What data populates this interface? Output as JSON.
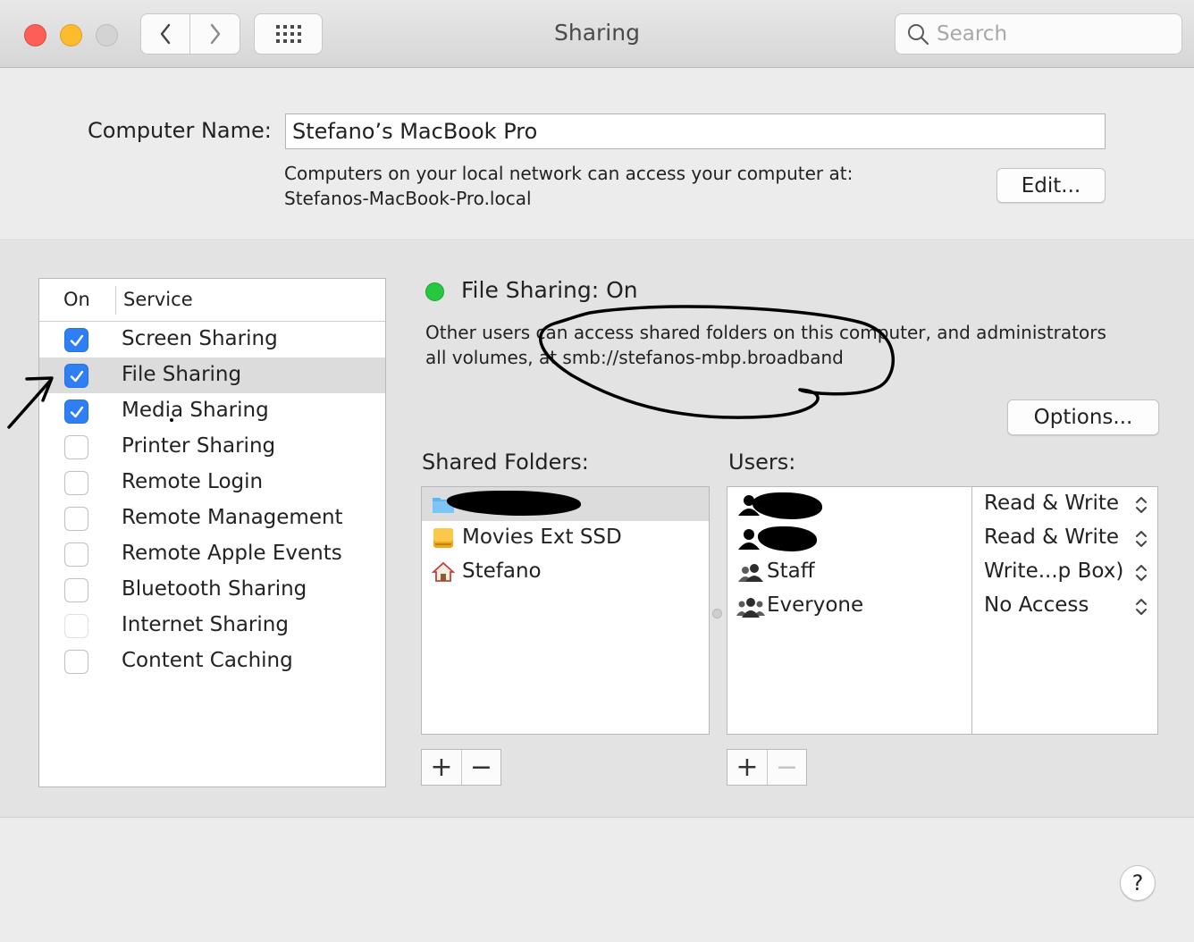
{
  "window": {
    "title": "Sharing",
    "search_placeholder": "Search"
  },
  "computer_name": {
    "label": "Computer Name:",
    "value": "Stefano’s MacBook Pro",
    "description_line1": "Computers on your local network can access your computer at:",
    "description_line2": "Stefanos-MacBook-Pro.local",
    "edit_label": "Edit..."
  },
  "service_list": {
    "col_on": "On",
    "col_service": "Service",
    "items": [
      {
        "label": "Screen Sharing",
        "checked": true
      },
      {
        "label": "File Sharing",
        "checked": true,
        "selected": true
      },
      {
        "label": "Media Sharing",
        "checked": true
      },
      {
        "label": "Printer Sharing",
        "checked": false
      },
      {
        "label": "Remote Login",
        "checked": false
      },
      {
        "label": "Remote Management",
        "checked": false
      },
      {
        "label": "Remote Apple Events",
        "checked": false
      },
      {
        "label": "Bluetooth Sharing",
        "checked": false
      },
      {
        "label": "Internet Sharing",
        "checked": false,
        "disabled": true
      },
      {
        "label": "Content Caching",
        "checked": false
      }
    ]
  },
  "status": {
    "text": "File Sharing: On",
    "color": "#27c840",
    "description_line1": "Other users can access shared folders on this computer, and administrators",
    "description_line2": "all volumes, at smb://stefanos-mbp.broadband"
  },
  "options_label": "Options...",
  "shared_folders": {
    "label": "Shared Folders:",
    "items": [
      {
        "label": "",
        "icon": "folder-icon",
        "selected": true
      },
      {
        "label": "Movies Ext SSD",
        "icon": "drive-icon"
      },
      {
        "label": "Stefano",
        "icon": "home-icon"
      }
    ]
  },
  "users": {
    "label": "Users:",
    "items": [
      {
        "name": "",
        "icon": "user-icon",
        "permission": "Read & Write"
      },
      {
        "name": "",
        "icon": "user-icon",
        "permission": "Read & Write"
      },
      {
        "name": "Staff",
        "icon": "group-icon",
        "permission": "Write...p Box)"
      },
      {
        "name": "Everyone",
        "icon": "everyone-icon",
        "permission": "No Access"
      }
    ]
  },
  "buttons": {
    "add": "+",
    "remove": "−",
    "help": "?"
  },
  "colors": {
    "accent": "#2f7ef6",
    "close": "#fc5f57",
    "minimize": "#fdbc2e"
  }
}
